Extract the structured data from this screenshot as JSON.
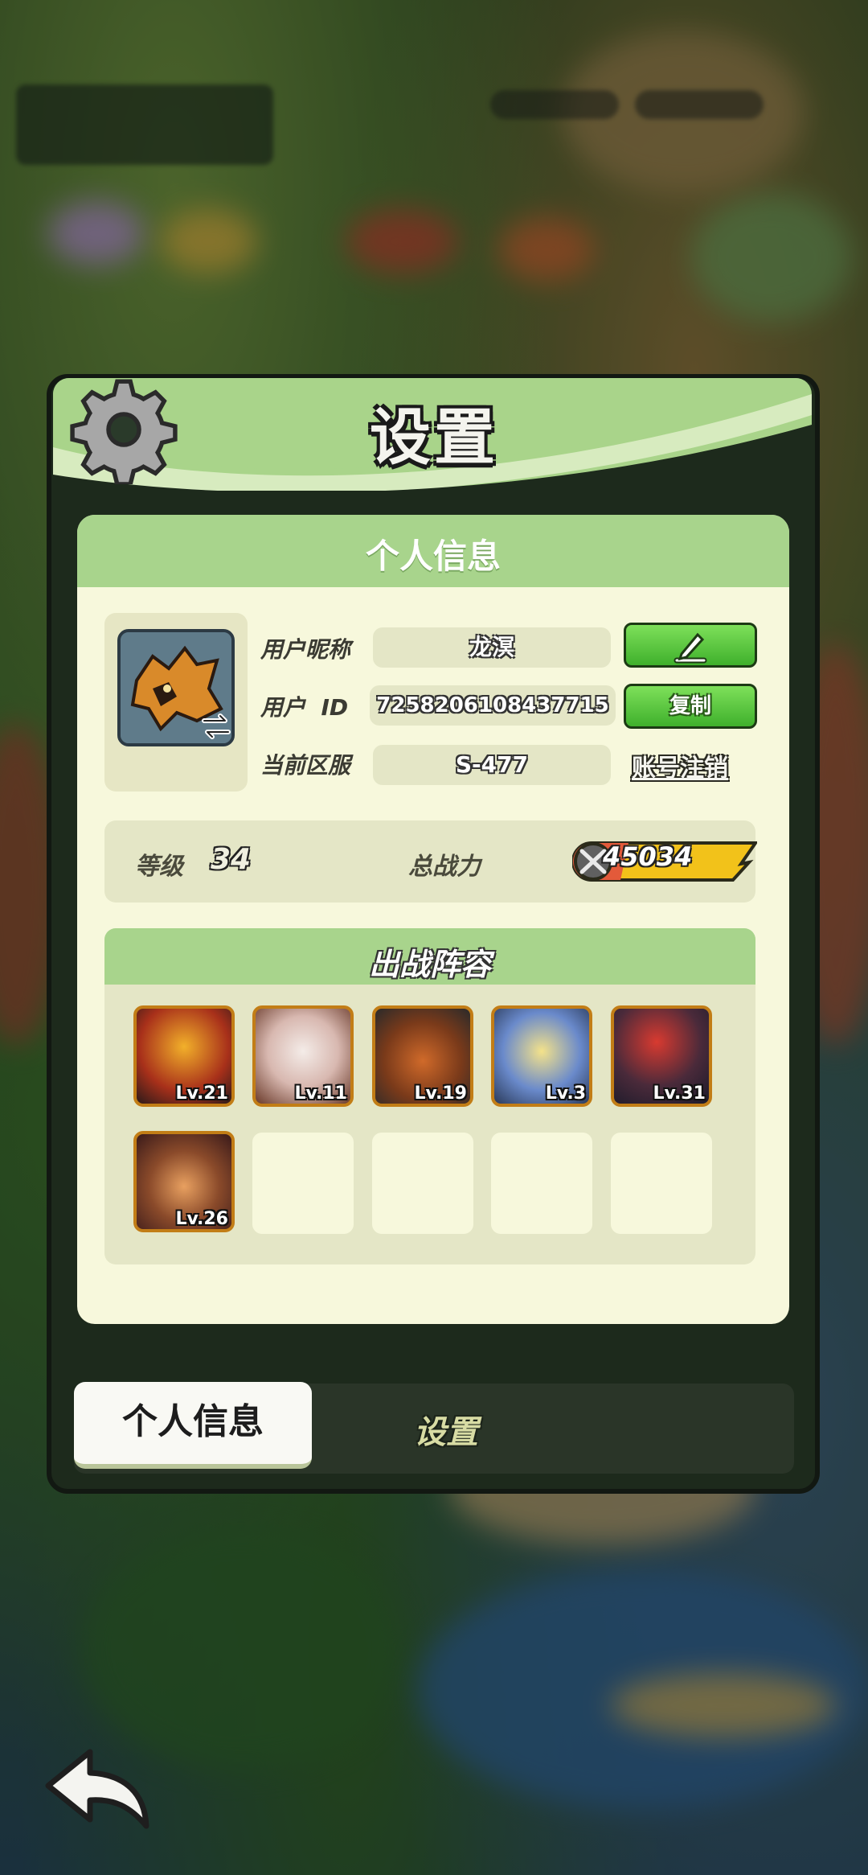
{
  "dialog": {
    "title": "设置"
  },
  "profile_panel": {
    "title": "个人信息",
    "nickname_label": "用户昵称",
    "nickname_value": "龙溟",
    "edit_icon": "pencil-icon",
    "user_id_label": "用户  ID",
    "user_id_value": "7258206108437715",
    "copy_label": "复制",
    "server_label": "当前区服",
    "server_value": "S-477",
    "delete_account_label": "账号注销",
    "level_label": "等级",
    "level_value": "34",
    "power_label": "总战力",
    "power_value": "45034"
  },
  "lineup": {
    "title": "出战阵容",
    "heroes": [
      {
        "level": "Lv.21"
      },
      {
        "level": "Lv.11"
      },
      {
        "level": "Lv.19"
      },
      {
        "level": "Lv.3"
      },
      {
        "level": "Lv.31"
      },
      {
        "level": "Lv.26"
      }
    ]
  },
  "tabs": {
    "active": "个人信息",
    "other": "设置"
  },
  "colors": {
    "header_green": "#a9d48a",
    "button_green": "#4fc236",
    "panel_cream": "#f7f8dc",
    "hero_border": "#c27d16"
  }
}
